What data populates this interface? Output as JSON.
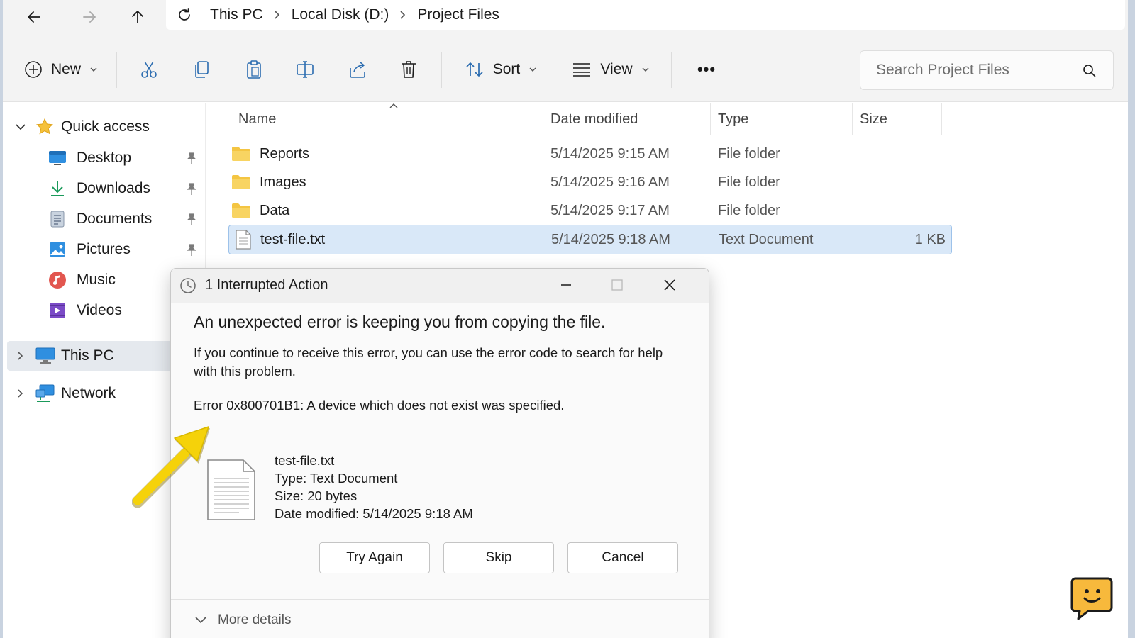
{
  "breadcrumb": {
    "items": [
      "This PC",
      "Local Disk (D:)",
      "Project Files"
    ]
  },
  "toolbar": {
    "new_label": "New",
    "sort_label": "Sort",
    "view_label": "View",
    "more_label": "•••"
  },
  "search": {
    "placeholder": "Search Project Files"
  },
  "sidebar": {
    "quick_access": "Quick access",
    "items": [
      {
        "label": "Desktop",
        "icon": "desktop-icon",
        "pinned": true
      },
      {
        "label": "Downloads",
        "icon": "downloads-icon",
        "pinned": true
      },
      {
        "label": "Documents",
        "icon": "documents-icon",
        "pinned": true
      },
      {
        "label": "Pictures",
        "icon": "pictures-icon",
        "pinned": true
      },
      {
        "label": "Music",
        "icon": "music-icon",
        "pinned": false
      },
      {
        "label": "Videos",
        "icon": "videos-icon",
        "pinned": false
      }
    ],
    "this_pc": "This PC",
    "network": "Network"
  },
  "filelist": {
    "columns": [
      "Name",
      "Date modified",
      "Type",
      "Size"
    ],
    "rows": [
      {
        "name": "Reports",
        "date": "5/14/2025 9:15 AM",
        "type": "File folder",
        "size": "",
        "icon": "folder-icon"
      },
      {
        "name": "Images",
        "date": "5/14/2025 9:16 AM",
        "type": "File folder",
        "size": "",
        "icon": "folder-icon"
      },
      {
        "name": "Data",
        "date": "5/14/2025 9:17 AM",
        "type": "File folder",
        "size": "",
        "icon": "folder-icon"
      },
      {
        "name": "test-file.txt",
        "date": "5/14/2025 9:18 AM",
        "type": "Text Document",
        "size": "1 KB",
        "icon": "text-file-icon",
        "selected": true
      }
    ]
  },
  "dialog": {
    "title": "1 Interrupted Action",
    "heading": "An unexpected error is keeping you from copying the file.",
    "body": "If you continue to receive this error, you can use the error code to search for help with this problem.",
    "error": "Error 0x800701B1: A device which does not exist was specified.",
    "file": {
      "name": "test-file.txt",
      "type": "Type: Text Document",
      "size": "Size: 20 bytes",
      "date": "Date modified: 5/14/2025 9:18 AM"
    },
    "buttons": {
      "try_again": "Try Again",
      "skip": "Skip",
      "cancel": "Cancel"
    },
    "more_details": "More details"
  },
  "colors": {
    "accent": "#0067c0",
    "selection_bg": "#d9e8f8",
    "folder_yellow": "#f4c542",
    "annotation_arrow": "#f5d20a"
  }
}
